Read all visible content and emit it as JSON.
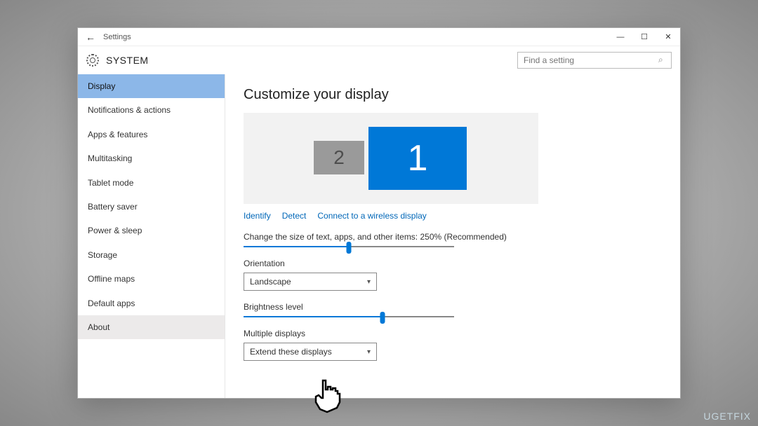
{
  "titlebar": {
    "back_glyph": "←",
    "title": "Settings",
    "minimize": "—",
    "maximize": "☐",
    "close": "✕"
  },
  "header": {
    "title": "SYSTEM",
    "search_placeholder": "Find a setting"
  },
  "sidebar": {
    "items": [
      {
        "label": "Display",
        "selected": true
      },
      {
        "label": "Notifications & actions"
      },
      {
        "label": "Apps & features"
      },
      {
        "label": "Multitasking"
      },
      {
        "label": "Tablet mode"
      },
      {
        "label": "Battery saver"
      },
      {
        "label": "Power & sleep"
      },
      {
        "label": "Storage"
      },
      {
        "label": "Offline maps"
      },
      {
        "label": "Default apps"
      },
      {
        "label": "About",
        "about": true
      }
    ]
  },
  "content": {
    "heading": "Customize your display",
    "monitor1": "1",
    "monitor2": "2",
    "links": {
      "identify": "Identify",
      "detect": "Detect",
      "connect": "Connect to a wireless display"
    },
    "scale_label": "Change the size of text, apps, and other items: 250% (Recommended)",
    "scale_percent": 50,
    "orientation_label": "Orientation",
    "orientation_value": "Landscape",
    "brightness_label": "Brightness level",
    "brightness_percent": 66,
    "multiple_label": "Multiple displays",
    "multiple_value": "Extend these displays"
  },
  "watermark": "UGETFIX"
}
